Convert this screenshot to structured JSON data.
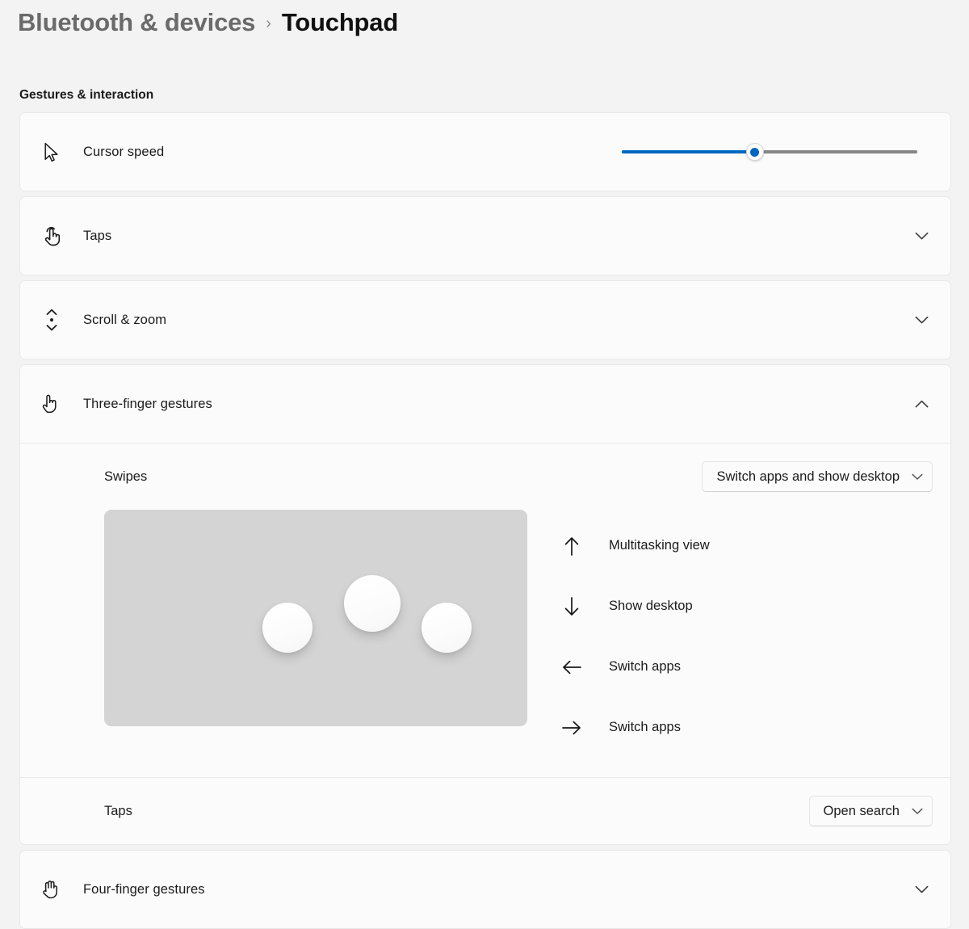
{
  "breadcrumb": {
    "parent": "Bluetooth & devices",
    "separator": "›",
    "current": "Touchpad"
  },
  "section": {
    "title": "Gestures & interaction"
  },
  "cards": {
    "cursor_speed": {
      "label": "Cursor speed",
      "icon": "cursor-arrow-icon",
      "slider": {
        "value_percent": 45,
        "fill_color": "#0067c0",
        "track_color": "#868686",
        "thumb_color": "#ffffff"
      }
    },
    "taps": {
      "label": "Taps",
      "icon": "tap-hand-icon",
      "chevron": "chevron-down-icon"
    },
    "scroll_zoom": {
      "label": "Scroll & zoom",
      "icon": "scroll-updown-icon",
      "chevron": "chevron-down-icon"
    },
    "three_finger": {
      "label": "Three-finger gestures",
      "icon": "three-finger-hand-icon",
      "chevron": "chevron-up-icon",
      "expanded": true,
      "swipes": {
        "label": "Swipes",
        "dropdown_value": "Switch apps and show desktop",
        "dropdown_chevron": "chevron-down-icon"
      },
      "illustration": {
        "name": "touchpad-three-finger-illustration",
        "surface_color": "#d4d4d4",
        "finger_count": 3
      },
      "gestures": [
        {
          "direction": "up",
          "arrow": "↑",
          "label": "Multitasking view"
        },
        {
          "direction": "down",
          "arrow": "↓",
          "label": "Show desktop"
        },
        {
          "direction": "left",
          "arrow": "←",
          "label": "Switch apps"
        },
        {
          "direction": "right",
          "arrow": "→",
          "label": "Switch apps"
        }
      ],
      "taps": {
        "label": "Taps",
        "dropdown_value": "Open search",
        "dropdown_chevron": "chevron-down-icon"
      }
    },
    "four_finger": {
      "label": "Four-finger gestures",
      "icon": "four-finger-hand-icon",
      "chevron": "chevron-down-icon"
    }
  },
  "colors": {
    "page_background": "#f3f3f3",
    "card_background": "#fbfbfb",
    "accent": "#0067c0",
    "text_primary": "#1b1b1b",
    "text_secondary": "#6a6a6a"
  }
}
